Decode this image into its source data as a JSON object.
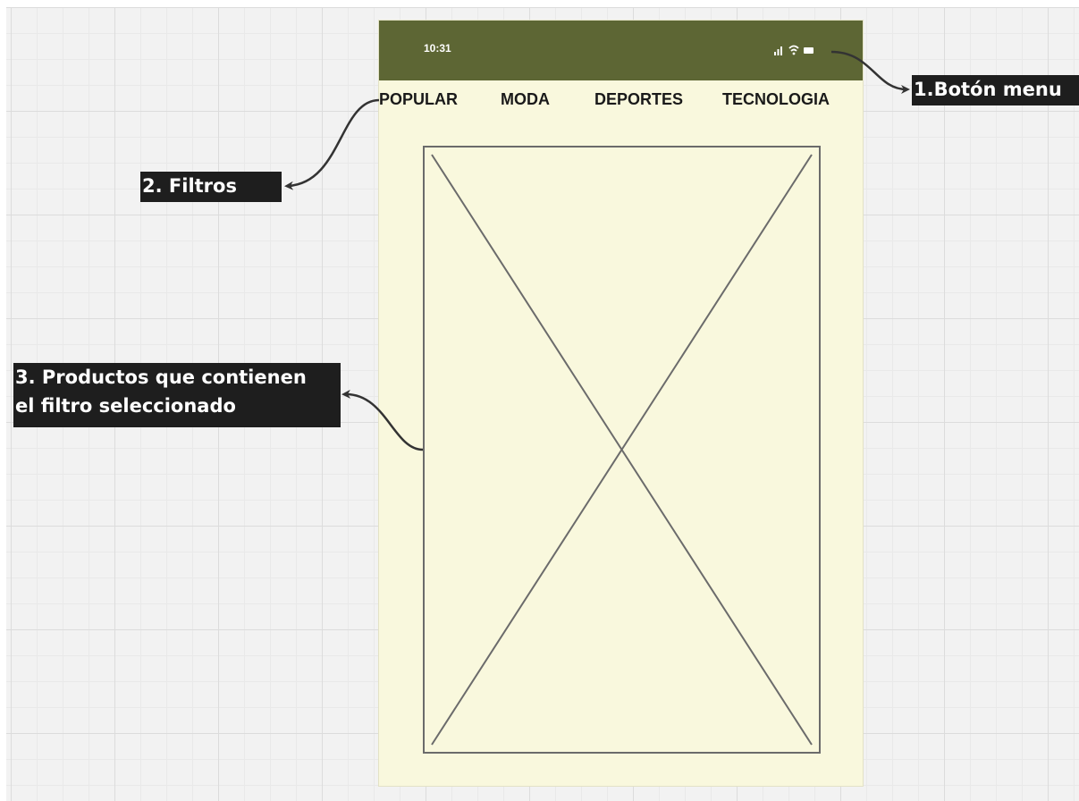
{
  "phone": {
    "status_bar": {
      "time": "10:31",
      "icons": [
        "signal-icon",
        "wifi-icon",
        "battery-icon"
      ],
      "color": "#5d6634"
    },
    "tabs": [
      {
        "label": "POPULAR"
      },
      {
        "label": "MODA"
      },
      {
        "label": "DEPORTES"
      },
      {
        "label": "TECNOLOGIA"
      }
    ],
    "background": "#f9f8dd",
    "product_placeholder": "image-placeholder"
  },
  "annotations": [
    {
      "label": "1.Botón menu"
    },
    {
      "label": "2. Filtros"
    },
    {
      "lines": [
        "3. Productos que contienen",
        "el filtro seleccionado"
      ]
    }
  ]
}
